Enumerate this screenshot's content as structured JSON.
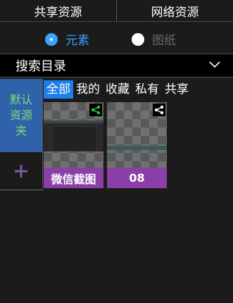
{
  "top_tabs": [
    "共享资源",
    "网络资源"
  ],
  "radio": {
    "options": [
      {
        "label": "元素",
        "selected": true
      },
      {
        "label": "图纸",
        "selected": false
      }
    ],
    "accent": "#3aa0ff"
  },
  "search": {
    "label": "搜索目录",
    "icon": "chevron-down-icon"
  },
  "sidebar": {
    "default_folder": "默认资源夹",
    "add_icon": "plus-icon",
    "folder_color": "#2f62a9",
    "folder_text_color": "#7ce07c"
  },
  "filters": {
    "items": [
      "全部",
      "我的",
      "收藏",
      "私有",
      "共享"
    ],
    "active": "全部",
    "active_color": "#1e7fe8"
  },
  "thumbnails": [
    {
      "caption": "微信截图",
      "share_color": "#27c93f",
      "icon": "share-icon"
    },
    {
      "caption": "08",
      "share_color": "#ffffff",
      "icon": "share-icon"
    }
  ],
  "caption_color": "#8a3fa8"
}
